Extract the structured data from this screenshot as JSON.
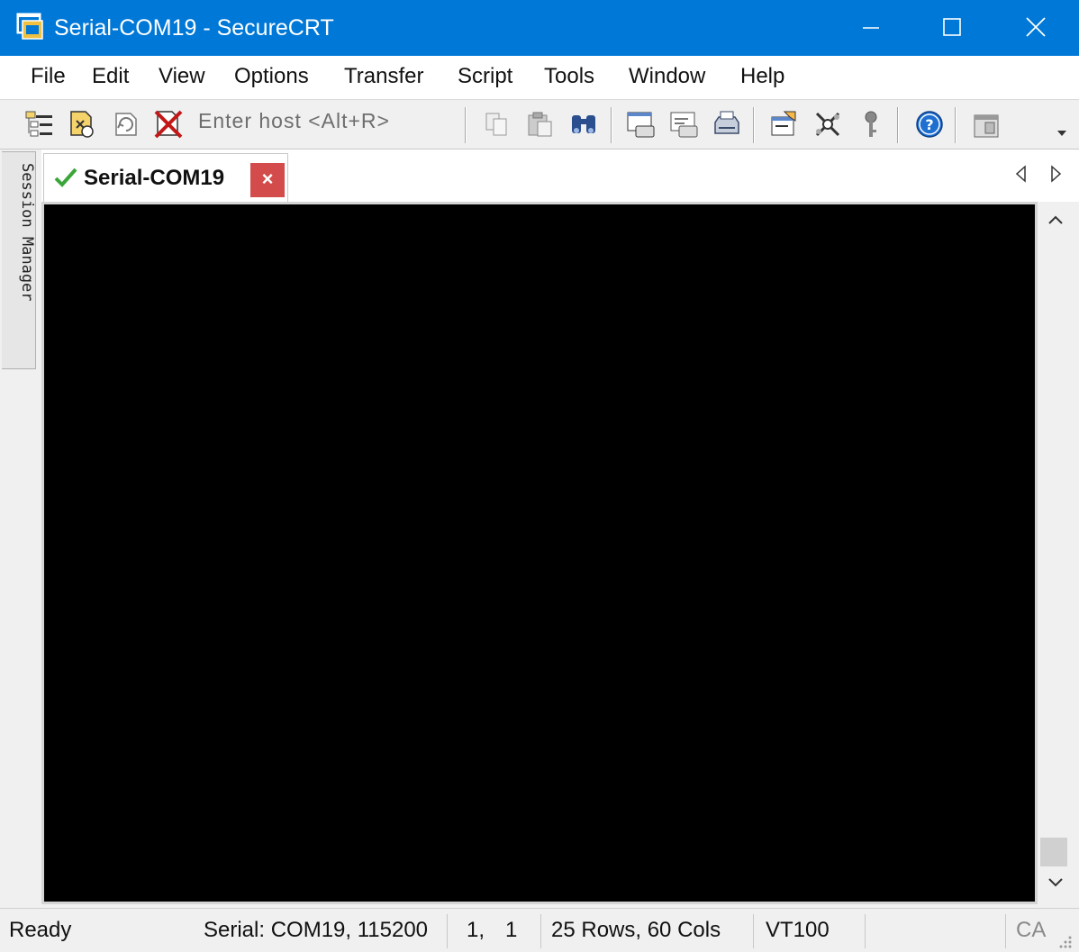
{
  "window": {
    "title": "Serial-COM19 - SecureCRT",
    "accent": "#0078d7"
  },
  "menubar": {
    "items": [
      "File",
      "Edit",
      "View",
      "Options",
      "Transfer",
      "Script",
      "Tools",
      "Window",
      "Help"
    ]
  },
  "toolbar": {
    "host_placeholder": "Enter host <Alt+R>",
    "icons": [
      "connect-icon",
      "quick-connect-icon",
      "reconnect-icon",
      "disconnect-icon",
      "copy-icon",
      "paste-icon",
      "find-icon",
      "print-screen-icon",
      "print-selection-icon",
      "print-icon",
      "session-options-icon",
      "global-options-icon",
      "keymap-icon",
      "help-icon",
      "sftp-icon"
    ]
  },
  "sidebar": {
    "session_manager_label": "Session Manager"
  },
  "tabs": [
    {
      "label": "Serial-COM19",
      "status": "connected",
      "close_label": "×",
      "close_color": "#d34b4b"
    }
  ],
  "terminal": {
    "background": "#000000"
  },
  "statusbar": {
    "state": "Ready",
    "connection": "Serial: COM19, 115200",
    "cursor_row": "1,",
    "cursor_col": "1",
    "size": "25 Rows, 60 Cols",
    "emulation": "VT100",
    "caps": "CA"
  }
}
